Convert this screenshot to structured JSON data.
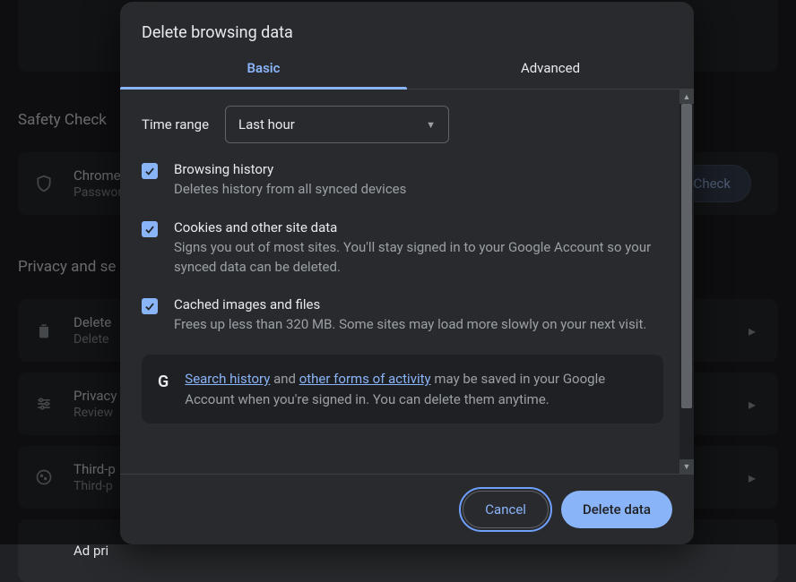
{
  "background": {
    "safety_heading": "Safety Check",
    "chrome_row": {
      "title": "Chrome",
      "subtitle": "Passwor"
    },
    "safety_button": "y Check",
    "privacy_heading": "Privacy and se",
    "rows": [
      {
        "title": "Delete",
        "subtitle": "Delete"
      },
      {
        "title": "Privacy",
        "subtitle": "Review"
      },
      {
        "title": "Third-p",
        "subtitle": "Third-p"
      },
      {
        "title": "Ad pri",
        "subtitle": ""
      }
    ]
  },
  "dialog": {
    "title": "Delete browsing data",
    "tabs": {
      "basic": "Basic",
      "advanced": "Advanced"
    },
    "time_range_label": "Time range",
    "time_range_value": "Last hour",
    "options": [
      {
        "title": "Browsing history",
        "desc": "Deletes history from all synced devices",
        "checked": true
      },
      {
        "title": "Cookies and other site data",
        "desc": "Signs you out of most sites. You'll stay signed in to your Google Account so your synced data can be deleted.",
        "checked": true
      },
      {
        "title": "Cached images and files",
        "desc": "Frees up less than 320 MB. Some sites may load more slowly on your next visit.",
        "checked": true
      }
    ],
    "info": {
      "link1": "Search history",
      "mid1": " and ",
      "link2": "other forms of activity",
      "rest": " may be saved in your Google Account when you're signed in. You can delete them anytime."
    },
    "buttons": {
      "cancel": "Cancel",
      "delete": "Delete data"
    }
  }
}
